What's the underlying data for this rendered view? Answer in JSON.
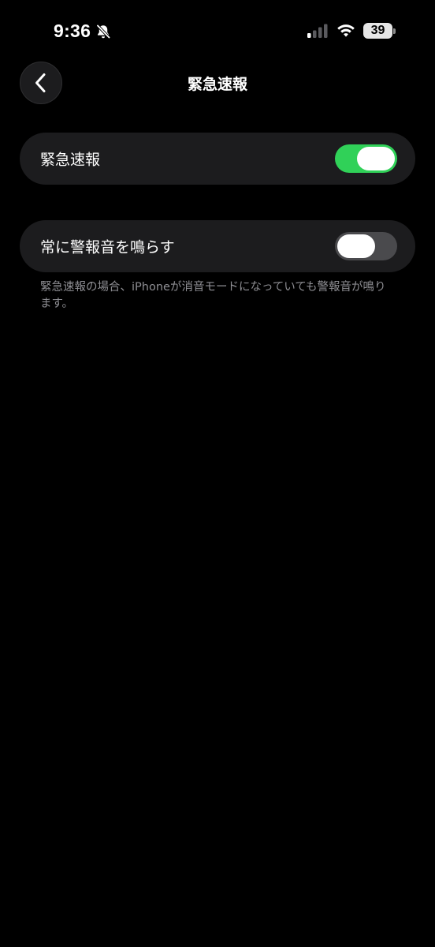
{
  "status_bar": {
    "time": "9:36",
    "battery_level": "39",
    "silent_icon": "bell-slash-icon",
    "signal_icon": "signal-icon",
    "wifi_icon": "wifi-icon"
  },
  "nav": {
    "back_icon": "chevron-left-icon",
    "title": "緊急速報"
  },
  "settings": [
    {
      "label": "緊急速報",
      "toggle_on": true
    },
    {
      "label": "常に警報音を鳴らす",
      "toggle_on": false
    }
  ],
  "footnote": "緊急速報の場合、iPhoneが消音モードになっていても警報音が鳴ります。",
  "colors": {
    "background": "#000000",
    "cell_background": "#1c1c1e",
    "toggle_on": "#30d158",
    "toggle_off": "#4a4a4d",
    "secondary_text": "#8e8e93"
  }
}
